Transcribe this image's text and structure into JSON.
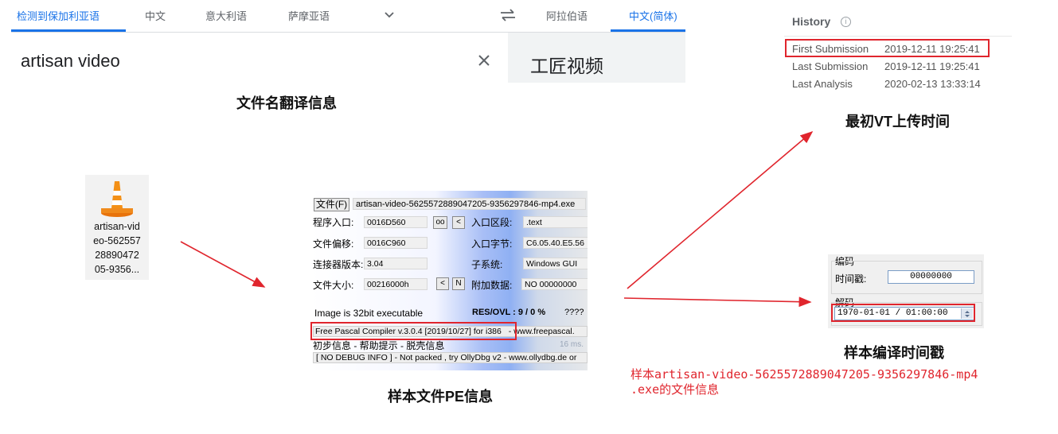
{
  "translate": {
    "source_tabs": [
      "检测到保加利亚语",
      "中文",
      "意大利语",
      "萨摩亚语"
    ],
    "target_tabs": [
      "阿拉伯语",
      "中文(简体)"
    ],
    "source_text": "artisan video",
    "target_text": "工匠视频"
  },
  "captions": {
    "filename_translation": "文件名翻译信息",
    "first_vt_upload": "最初VT上传时间",
    "pe_info": "样本文件PE信息",
    "compile_timestamp": "样本编译时间戳"
  },
  "file_icon": {
    "lines": [
      "artisan-vid",
      "eo-562557",
      "28890472",
      "05-9356..."
    ],
    "icon": "vlc-cone-icon"
  },
  "pe_tool": {
    "file_button": "文件(F)",
    "file_path": "artisan-video-5625572889047205-9356297846-mp4.exe",
    "entry_point_label": "程序入口:",
    "entry_point": "0016D560",
    "oo_button": "oo",
    "lt_button": "<",
    "entry_section_label": "入口区段:",
    "entry_section": ".text",
    "file_offset_label": "文件偏移:",
    "file_offset": "0016C960",
    "entry_bytes_label": "入口字节:",
    "entry_bytes": "C6.05.40.E5.56",
    "linker_label": "连接器版本:",
    "linker": "3.04",
    "subsystem_label": "子系统:",
    "subsystem": "Windows GUI",
    "file_size_label": "文件大小:",
    "file_size": "00216000h",
    "n_button": "N",
    "overlay_label": "附加数据:",
    "overlay": "NO  00000000",
    "image_info": "Image is 32bit executable",
    "res_ovl": "RES/OVL : 9 / 0 %",
    "unknown": "????",
    "compiler": "Free Pascal Compiler v.3.0.4 [2019/10/27] for i386",
    "compiler_site": "- www.freepascal.",
    "initial_info": "初步信息 - 帮助提示 - 脱壳信息",
    "timing": "16 ms.",
    "debug_info": "[ NO DEBUG INFO ] - Not packed , try OllyDbg v2 - www.ollydbg.de or"
  },
  "history": {
    "title": "History",
    "rows": [
      {
        "label": "First Submission",
        "value": "2019-12-11 19:25:41"
      },
      {
        "label": "Last Submission",
        "value": "2019-12-11 19:25:41"
      },
      {
        "label": "Last Analysis",
        "value": "2020-02-13 13:33:14"
      }
    ]
  },
  "timestamp_tool": {
    "encode_group": "编码",
    "timestamp_label": "时间戳:",
    "timestamp_value": "00000000",
    "decode_group": "解码",
    "decoded_value": "1970-01-01 / 01:00:00"
  },
  "note": {
    "line1": "样本artisan-video-5625572889047205-9356297846-mp4",
    "line2": ".exe的文件信息"
  },
  "colors": {
    "accent": "#1a73e8",
    "annotation_red": "#e0252d"
  }
}
